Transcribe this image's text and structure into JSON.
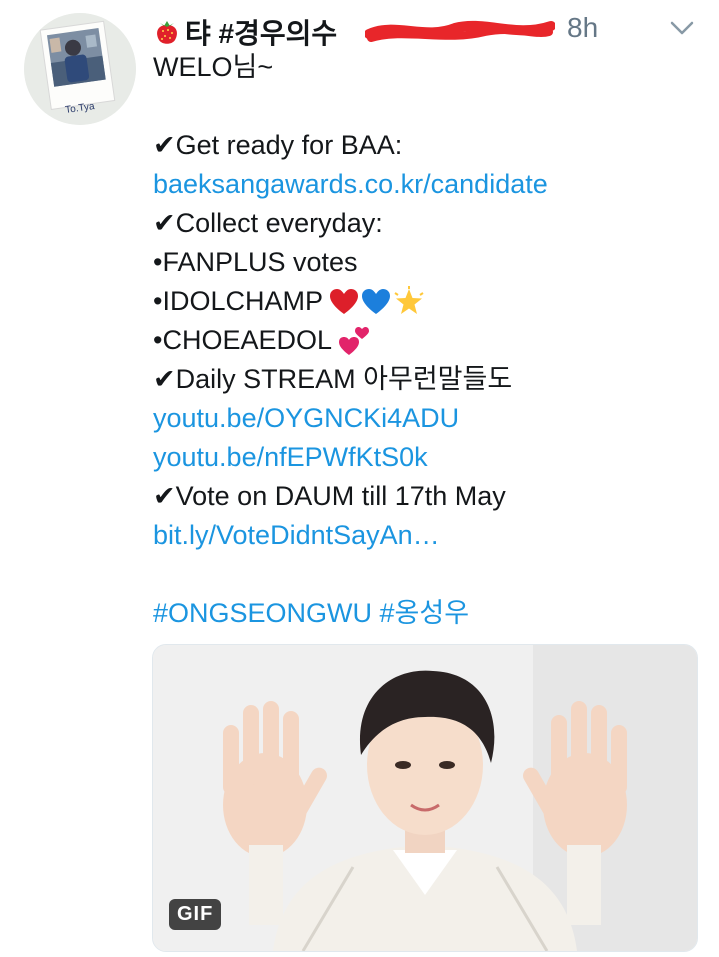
{
  "tweet": {
    "avatar_caption": "To.Tya",
    "display_name": "탸 #경우의수",
    "name_emoji": "strawberry",
    "handle_state": "redacted",
    "timestamp": "8h",
    "menu_icon": "chevron-down-icon",
    "lines": [
      {
        "text": "WELO님~"
      },
      {
        "text": ""
      },
      {
        "text": "✔Get ready for BAA:"
      },
      {
        "text": "baeksangawards.co.kr/candidate",
        "link": true
      },
      {
        "text": "✔Collect everyday:"
      },
      {
        "text": "•FANPLUS votes"
      },
      {
        "text": "•IDOLCHAMP",
        "emojis": [
          "red-heart",
          "blue-heart",
          "glowing-star"
        ]
      },
      {
        "text": "•CHOEAEDOL",
        "emojis": [
          "two-hearts"
        ]
      },
      {
        "text": "✔Daily STREAM 아무런말들도"
      },
      {
        "text": "youtu.be/OYGNCKi4ADU",
        "link": true
      },
      {
        "text": "youtu.be/nfEPWfKtS0k",
        "link": true
      },
      {
        "text": "✔Vote on DAUM till 17th May"
      },
      {
        "text": "bit.ly/VoteDidntSayAn…",
        "link": true
      },
      {
        "text": ""
      },
      {
        "text": "#ONGSEONGWU #옹성우",
        "link": true
      }
    ],
    "media": {
      "type": "gif",
      "badge": "GIF",
      "description_icon": "person-waving-image"
    },
    "colors": {
      "link": "#1b95e0",
      "text": "#14171a",
      "secondary": "#657786",
      "redaction": "#e8262a"
    }
  }
}
